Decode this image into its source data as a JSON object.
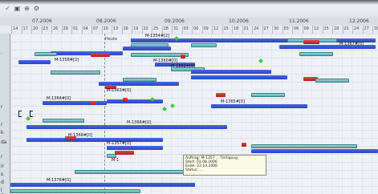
{
  "header": {
    "months": [
      "07.2006",
      "08.2006",
      "09.2006",
      "10.2006",
      "11.2006",
      "12.2006"
    ],
    "day_numbers": [
      "14",
      "17",
      "20",
      "23",
      "26",
      "29",
      "01",
      "04",
      "07",
      "10",
      "13",
      "16",
      "19",
      "22",
      "25",
      "28",
      "31",
      "03",
      "06",
      "09",
      "12",
      "15",
      "18",
      "21",
      "24",
      "27",
      "30",
      "03",
      "06",
      "09",
      "12",
      "15",
      "18",
      "21",
      "24",
      "27",
      "30"
    ]
  },
  "rows": {
    "labels": [
      "",
      ".",
      "r",
      "r",
      "k",
      "da",
      "r",
      "ir",
      "s",
      "d",
      "l En"
    ]
  },
  "milestone": {
    "label": "Heute"
  },
  "tasks": [
    {
      "label": "M-1354#[2]"
    },
    {
      "label": "M-1358#[2]"
    },
    {
      "label": "M-1360#[0]"
    },
    {
      "label": "M-1362#[0]"
    },
    {
      "label": "M-1363#[0]"
    },
    {
      "label": "M-1364#[0]"
    },
    {
      "label": "M-1365#[0]"
    },
    {
      "label": "M-1366#[0]"
    },
    {
      "label": "M-1368#[0]"
    },
    {
      "label": "M-1357#[0]"
    },
    {
      "label": "M-1"
    },
    {
      "label": "M-1378#[0]"
    },
    {
      "label": "M-1367#[0]"
    }
  ],
  "tooltip": {
    "lines": [
      "Auftrag: M-1357 ... Fertigung",
      "Start: 03.08.2006",
      "Ende: 22.10.2006",
      "Status: ..."
    ]
  },
  "colors": {
    "bar_blue": "#2f49c8",
    "bar_teal": "#7cc0c6",
    "bar_red": "#c02a2a",
    "milestone_green": "#3ec43e"
  }
}
